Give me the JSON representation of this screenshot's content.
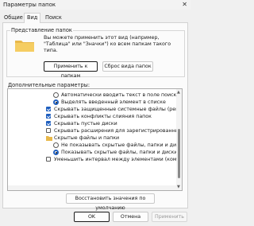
{
  "window": {
    "title": "Параметры папок",
    "close_glyph": "✕"
  },
  "tabs": [
    {
      "label": "Общие",
      "active": false
    },
    {
      "label": "Вид",
      "active": true
    },
    {
      "label": "Поиск",
      "active": false
    }
  ],
  "folder_view": {
    "group_title": "Представление папок",
    "description": "Вы можете применить этот вид (например, \"Таблица\" или \"Значки\") ко всем папкам такого типа.",
    "apply_button": "Применить к папкам",
    "reset_button": "Сброс вида папок"
  },
  "advanced": {
    "label": "Дополнительные параметры:",
    "items": [
      {
        "type": "radio",
        "checked": false,
        "text": "Автоматически вводить текст в поле поиска"
      },
      {
        "type": "radio",
        "checked": true,
        "text": "Выделять введенный элемент в списке"
      },
      {
        "type": "checkbox",
        "checked": true,
        "text": "Скрывать защищенные системные файлы (рекомен"
      },
      {
        "type": "checkbox",
        "checked": true,
        "text": "Скрывать конфликты слияния папок"
      },
      {
        "type": "checkbox",
        "checked": true,
        "text": "Скрывать пустые диски"
      },
      {
        "type": "checkbox",
        "checked": false,
        "text": "Скрывать расширения для зарегистрированных типо"
      },
      {
        "type": "folder",
        "checked": false,
        "text": "Скрытые файлы и папки"
      },
      {
        "type": "radio",
        "checked": false,
        "text": "Не показывать скрытые файлы, папки и диски"
      },
      {
        "type": "radio",
        "checked": true,
        "text": "Показывать скрытые файлы, папки и диски"
      },
      {
        "type": "checkbox",
        "checked": false,
        "text": "Уменьшить интервал между элементами (компактн"
      }
    ],
    "restore_button": "Восстановить значения по умолчанию"
  },
  "footer": {
    "ok": "OK",
    "cancel": "Отмена",
    "apply": "Применить"
  },
  "colors": {
    "accent": "#1f5fbf",
    "folder": "#e8b84a"
  }
}
